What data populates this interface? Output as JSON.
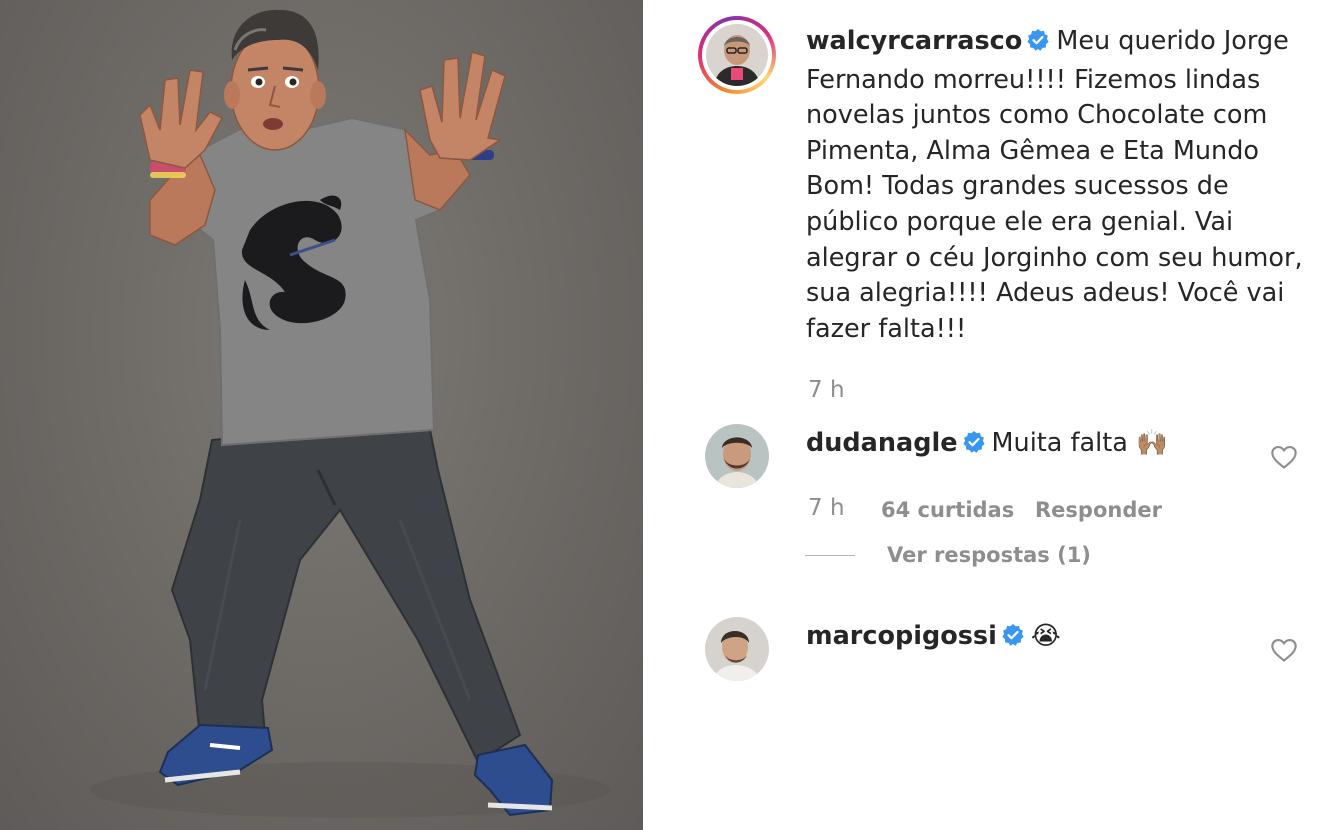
{
  "post": {
    "author": {
      "username": "walcyrcarrasco",
      "verified": true,
      "avatar": "walcyrcarrasco-avatar"
    },
    "caption": "Meu querido Jorge Fernando morreu!!!! Fizemos lindas novelas juntos como Chocolate com Pimenta, Alma Gêmea e Eta Mundo Bom! Todas grandes sucessos de público porque ele era genial. Vai alegrar o céu Jorginho com seu humor, sua alegria!!!! Adeus adeus! Você vai fazer falta!!!",
    "time": "7 h"
  },
  "comments": [
    {
      "username": "dudanagle",
      "verified": true,
      "text": "Muita falta",
      "emoji": "🙌🏽",
      "time": "7 h",
      "likes": "64 curtidas",
      "reply_label": "Responder",
      "view_replies": "Ver respostas (1)",
      "like_icon": "heart-outline-icon"
    },
    {
      "username": "marcopigossi",
      "verified": true,
      "text": "",
      "emoji": "😭",
      "like_icon": "heart-outline-icon"
    }
  ],
  "colors": {
    "text": "#262626",
    "muted": "#8e8e8e",
    "verified": "#3897f0",
    "shirt": "#858585",
    "jeans": "#3f4347",
    "shoe": "#2d4d8e"
  }
}
